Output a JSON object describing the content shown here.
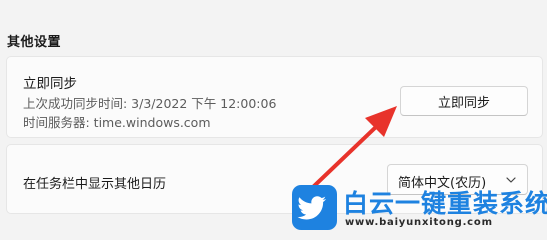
{
  "section": {
    "title": "其他设置"
  },
  "sync": {
    "title": "立即同步",
    "last_sync": "上次成功同步时间: 3/3/2022 下午 12:00:06",
    "time_server": "时间服务器: time.windows.com",
    "button_label": "立即同步"
  },
  "calendar": {
    "label": "在任务栏中显示其他日历",
    "selected_option": "简体中文(农历)"
  },
  "annotation": {
    "arrow_color": "#e8332b",
    "arrow_icon": "red-arrow-pointing-to-sync-button"
  },
  "watermark": {
    "title": "白云一键重装系统",
    "url": "www.baiyunxitong.com",
    "brand_color": "#1e82e0",
    "logo_icon": "bird-logo"
  }
}
